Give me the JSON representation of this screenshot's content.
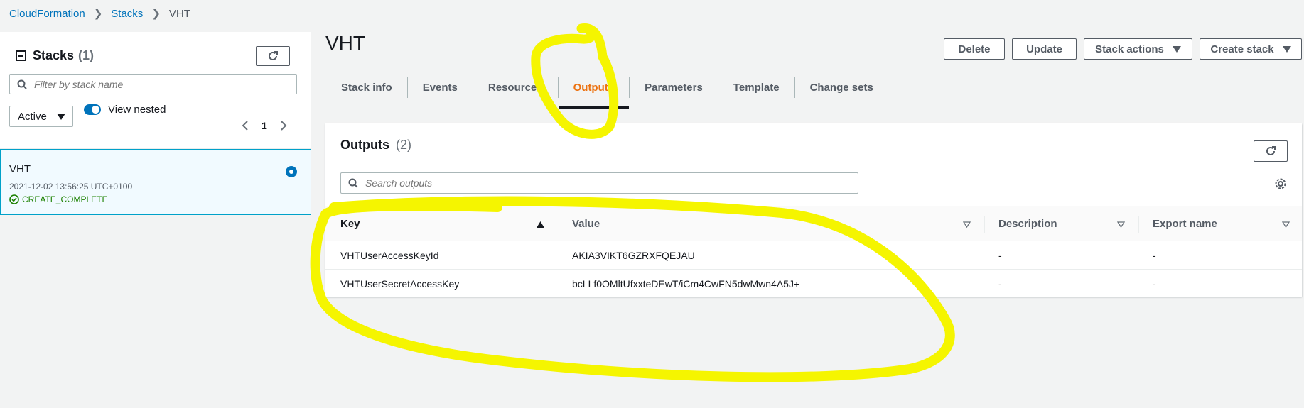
{
  "breadcrumb": {
    "items": [
      "CloudFormation",
      "Stacks",
      "VHT"
    ]
  },
  "sidebar": {
    "title": "Stacks",
    "count": "(1)",
    "filter_placeholder": "Filter by stack name",
    "status_filter": "Active",
    "view_nested_label": "View nested",
    "view_nested_on": true,
    "page": "1",
    "stack": {
      "name": "VHT",
      "timestamp": "2021-12-02 13:56:25 UTC+0100",
      "status": "CREATE_COMPLETE",
      "selected": true
    }
  },
  "main": {
    "title": "VHT",
    "actions": {
      "delete": "Delete",
      "update": "Update",
      "stack_actions": "Stack actions",
      "create_stack": "Create stack"
    },
    "tabs": [
      "Stack info",
      "Events",
      "Resources",
      "Outputs",
      "Parameters",
      "Template",
      "Change sets"
    ],
    "active_tab": "Outputs"
  },
  "outputs": {
    "title": "Outputs",
    "count": "(2)",
    "search_placeholder": "Search outputs",
    "columns": {
      "key": "Key",
      "value": "Value",
      "description": "Description",
      "export_name": "Export name"
    },
    "rows": [
      {
        "key": "VHTUserAccessKeyId",
        "value": "AKIA3VIKT6GZRXFQEJAU",
        "description": "-",
        "export_name": "-"
      },
      {
        "key": "VHTUserSecretAccessKey",
        "value": "bcLLf0OMltUfxxteDEwT/iCm4CwFN5dwMwn4A5J+",
        "description": "-",
        "export_name": "-"
      }
    ]
  },
  "colors": {
    "link": "#0073bb",
    "active_tab": "#ec7211",
    "success": "#1d8102",
    "highlight": "#f5f500"
  }
}
